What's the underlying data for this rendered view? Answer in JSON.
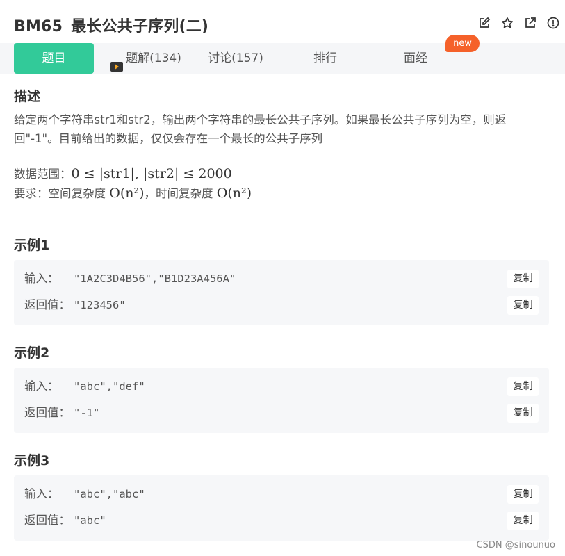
{
  "problem": {
    "code": "BM65",
    "title": "最长公共子序列(二)"
  },
  "header_icons": [
    "edit-icon",
    "star-icon",
    "external-link-icon",
    "report-icon"
  ],
  "tabs": [
    {
      "label": "题目",
      "active": true
    },
    {
      "label": "题解(134)",
      "icon": "video-icon"
    },
    {
      "label": "讨论(157)"
    },
    {
      "label": "排行"
    },
    {
      "label": "面经"
    }
  ],
  "badge": {
    "label": "new"
  },
  "description": {
    "heading": "描述",
    "text": "给定两个字符串str1和str2，输出两个字符串的最长公共子序列。如果最长公共子序列为空，则返回\"-1\"。目前给出的数据，仅仅会存在一个最长的公共子序列",
    "range_label": "数据范围：",
    "range_math": "0 ≤ |str1|, |str2| ≤ 2000",
    "req_label": "要求：",
    "space_label": "空间复杂度 ",
    "space_math": "O(n²)",
    "sep": "，",
    "time_label": "时间复杂度 ",
    "time_math": "O(n²)"
  },
  "examples": [
    {
      "heading": "示例1",
      "input_label": "输入：",
      "input": "\"1A2C3D4B56\",\"B1D23A456A\"",
      "output_label": "返回值：",
      "output": "\"123456\"",
      "copy": "复制"
    },
    {
      "heading": "示例2",
      "input_label": "输入：",
      "input": "\"abc\",\"def\"",
      "output_label": "返回值：",
      "output": "\"-1\"",
      "copy": "复制"
    },
    {
      "heading": "示例3",
      "input_label": "输入：",
      "input": "\"abc\",\"abc\"",
      "output_label": "返回值：",
      "output": "\"abc\"",
      "copy": "复制"
    }
  ],
  "watermark": "CSDN @sinounuo",
  "colors": {
    "accent": "#32ca99",
    "badge": "#f5612a",
    "tab_bar": "#f5f6f8",
    "example_bg": "#f6f7f9"
  }
}
